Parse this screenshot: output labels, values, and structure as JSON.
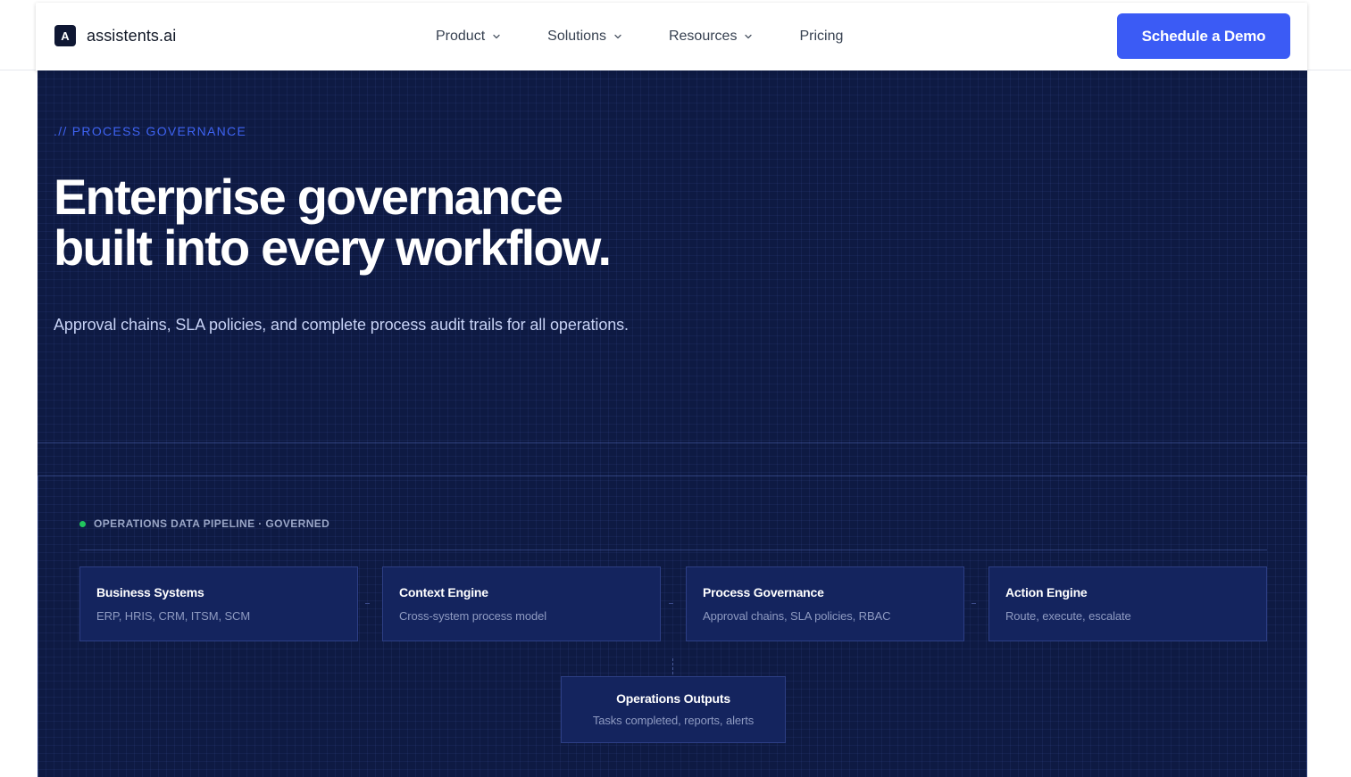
{
  "brand": {
    "mark": "A",
    "name": "assistents.ai"
  },
  "nav": {
    "items": [
      {
        "label": "Product",
        "has_dropdown": true
      },
      {
        "label": "Solutions",
        "has_dropdown": true
      },
      {
        "label": "Resources",
        "has_dropdown": true
      },
      {
        "label": "Pricing",
        "has_dropdown": false
      }
    ],
    "cta_label": "Schedule a Demo"
  },
  "hero": {
    "eyebrow_prefix": ".//",
    "eyebrow": "PROCESS GOVERNANCE",
    "headline_line1": "Enterprise governance",
    "headline_line2": "built into every workflow.",
    "subhead": "Approval chains, SLA policies, and complete process audit trails for all operations."
  },
  "pipeline": {
    "title": "OPERATIONS DATA PIPELINE · GOVERNED",
    "status_color": "#22c55e",
    "stages": [
      {
        "title": "Business Systems",
        "subtitle": "ERP, HRIS, CRM, ITSM, SCM"
      },
      {
        "title": "Context Engine",
        "subtitle": "Cross-system process model"
      },
      {
        "title": "Process Governance",
        "subtitle": "Approval chains, SLA policies, RBAC"
      },
      {
        "title": "Action Engine",
        "subtitle": "Route, execute, escalate"
      }
    ],
    "output": {
      "title": "Operations Outputs",
      "subtitle": "Tasks completed, reports, alerts"
    }
  },
  "colors": {
    "accent": "#3b5bf5",
    "hero_background": "#0e1a43",
    "card_background": "#14245e"
  }
}
